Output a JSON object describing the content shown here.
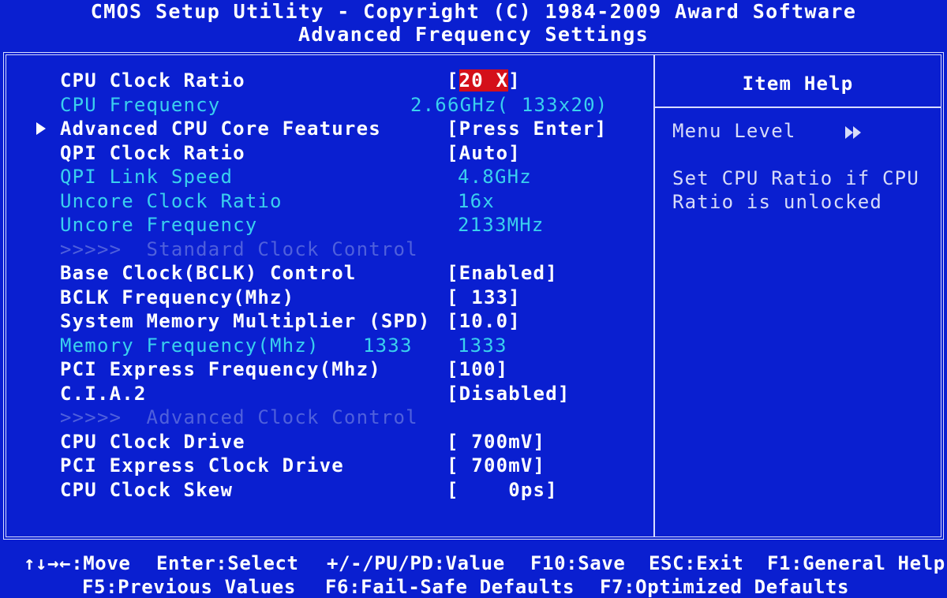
{
  "header": {
    "title": "CMOS Setup Utility - Copyright (C) 1984-2009 Award Software",
    "subtitle": "Advanced Frequency Settings"
  },
  "settings": [
    {
      "label": "CPU Clock Ratio",
      "value": "[20 X]",
      "type": "option",
      "selected": true
    },
    {
      "label": "CPU Frequency",
      "value": "2.66GHz( 133x20)",
      "type": "info"
    },
    {
      "label": "Advanced CPU Core Features",
      "value": "[Press Enter]",
      "type": "submenu"
    },
    {
      "label": "QPI Clock Ratio",
      "value": "[Auto]",
      "type": "option"
    },
    {
      "label": "QPI Link Speed",
      "value": "4.8GHz",
      "type": "info"
    },
    {
      "label": "Uncore Clock Ratio",
      "value": "16x",
      "type": "info"
    },
    {
      "label": "Uncore Frequency",
      "value": "2133MHz",
      "type": "info"
    },
    {
      "label": ">>>>>  Standard Clock Control",
      "value": "",
      "type": "section"
    },
    {
      "label": "Base Clock(BCLK) Control",
      "value": "[Enabled]",
      "type": "option"
    },
    {
      "label": "BCLK Frequency(Mhz)",
      "value": "[ 133]",
      "type": "option"
    },
    {
      "label": "System Memory Multiplier (SPD)",
      "value": "[10.0]",
      "type": "option"
    },
    {
      "label": "Memory Frequency(Mhz)",
      "mid": "1333",
      "value": "1333",
      "type": "info"
    },
    {
      "label": "PCI Express Frequency(Mhz)",
      "value": "[100]",
      "type": "option"
    },
    {
      "label": "C.I.A.2",
      "value": "[Disabled]",
      "type": "option"
    },
    {
      "label": ">>>>>  Advanced Clock Control",
      "value": "",
      "type": "section"
    },
    {
      "label": "CPU Clock Drive",
      "value": "[ 700mV]",
      "type": "option"
    },
    {
      "label": "PCI Express Clock Drive",
      "value": "[ 700mV]",
      "type": "option"
    },
    {
      "label": "CPU Clock Skew",
      "value": "[    0ps]",
      "type": "option"
    }
  ],
  "help": {
    "title": "Item Help",
    "menu_level": "Menu Level",
    "line1": "Set CPU Ratio if CPU",
    "line2": "Ratio is unlocked"
  },
  "footer": {
    "move": "↑↓→←:Move",
    "select": "Enter:Select",
    "value": "+/-/PU/PD:Value",
    "save": "F10:Save",
    "exit": "ESC:Exit",
    "help": "F1:General Help",
    "previous": "F5:Previous Values",
    "failsafe": "F6:Fail-Safe Defaults",
    "optimized": "F7:Optimized Defaults"
  },
  "colors": {
    "background": "#0a1fd0",
    "info_text": "#3ad0ee",
    "section_text": "#4f60dc",
    "highlight": "#d4101a"
  }
}
